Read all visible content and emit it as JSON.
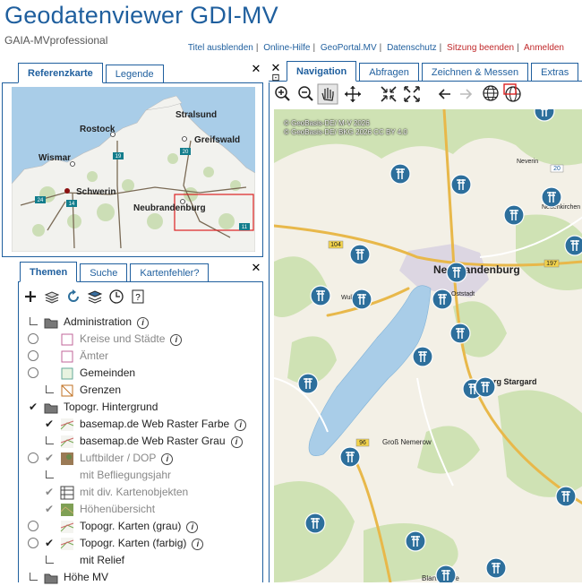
{
  "header": {
    "title": "Geodatenviewer GDI-MV",
    "subtitle": "GAIA-MVprofessional",
    "links": [
      {
        "label": "Titel ausblenden",
        "color": "#1f5f9e"
      },
      {
        "label": "Online-Hilfe",
        "color": "#1f5f9e"
      },
      {
        "label": "GeoPortal.MV",
        "color": "#1f5f9e"
      },
      {
        "label": "Datenschutz",
        "color": "#1f5f9e"
      },
      {
        "label": "Sitzung beenden",
        "color": "#c0282a"
      },
      {
        "label": "Anmelden",
        "color": "#c0282a"
      }
    ]
  },
  "left_tabs": {
    "referenzkarte": "Referenzkarte",
    "legende": "Legende"
  },
  "reference_map": {
    "cities": [
      "Stralsund",
      "Rostock",
      "Greifswald",
      "Wismar",
      "Schwerin",
      "Neubrandenburg"
    ],
    "road_shields": [
      "19",
      "20",
      "24",
      "14",
      "11"
    ]
  },
  "theme_tabs": {
    "themen": "Themen",
    "suche": "Suche",
    "kartenfehler": "Kartenfehler?"
  },
  "theme_tools": [
    "add-layer-icon",
    "layers-icon",
    "refresh-icon",
    "layer-stack-icon",
    "clock-icon",
    "help-icon"
  ],
  "layers": [
    {
      "label": "Administration",
      "type": "folder",
      "control": "line",
      "info": true
    },
    {
      "label": "Kreise und Städte",
      "type": "layer",
      "control": "radio",
      "info": true,
      "grey": true
    },
    {
      "label": "Ämter",
      "type": "layer",
      "control": "radio",
      "info": false,
      "grey": true
    },
    {
      "label": "Gemeinden",
      "type": "layer",
      "control": "radio",
      "info": false,
      "grey": false
    },
    {
      "label": "Grenzen",
      "type": "layer",
      "control": "line",
      "info": false,
      "grey": false
    },
    {
      "label": "Topogr. Hintergrund",
      "type": "folder",
      "control": "check",
      "info": false
    },
    {
      "label": "basemap.de Web Raster Farbe",
      "type": "layer",
      "control": "check",
      "info": true,
      "grey": false
    },
    {
      "label": "basemap.de Web Raster Grau",
      "type": "layer",
      "control": "line",
      "info": true,
      "grey": false
    },
    {
      "label": "Luftbilder / DOP",
      "type": "layer",
      "control": "radio-check",
      "info": true,
      "grey": true
    },
    {
      "label": "mit Befliegungsjahr",
      "type": "sub",
      "control": "line",
      "info": false,
      "grey": true
    },
    {
      "label": "mit div. Kartenobjekten",
      "type": "sub",
      "control": "check",
      "info": false,
      "grey": true
    },
    {
      "label": "Höhenübersicht",
      "type": "sub",
      "control": "check",
      "info": false,
      "grey": true
    },
    {
      "label": "Topogr. Karten (grau)",
      "type": "layer",
      "control": "radio",
      "info": true,
      "grey": false
    },
    {
      "label": "Topogr. Karten (farbig)",
      "type": "layer",
      "control": "radio-check",
      "info": true,
      "grey": false
    },
    {
      "label": "mit Relief",
      "type": "sub",
      "control": "line",
      "info": false,
      "grey": false
    },
    {
      "label": "Höhe MV",
      "type": "folder",
      "control": "line",
      "info": false
    }
  ],
  "main_tabs": {
    "navigation": "Navigation",
    "abfragen": "Abfragen",
    "zeichnen": "Zeichnen & Messen",
    "extras": "Extras"
  },
  "nav_tools": [
    "zoom-in-icon",
    "zoom-out-icon",
    "pan-hand-icon",
    "move-icon",
    "zoom-to-center-icon",
    "full-extent-icon",
    "back-arrow-icon",
    "forward-arrow-icon",
    "globe-icon",
    "globe-select-icon"
  ],
  "main_map": {
    "attribution": [
      "© GeoBasis-DE/ M-V 2026",
      "© GeoBasis-DE/ BKG 2026 CC BY 4.0"
    ],
    "labels": [
      "Neubrandenburg",
      "Oststadt",
      "Neverin",
      "Neuenkirchen",
      "Wulkenzin",
      "Burg Stargard",
      "Groß Nemerow",
      "Blankensee"
    ],
    "road_numbers": [
      "20",
      "104",
      "197",
      "96"
    ]
  },
  "colors": {
    "brand": "#1f5f9e",
    "alert": "#c0282a",
    "marker": "#2d6f9c",
    "lake": "#a9cde8"
  }
}
